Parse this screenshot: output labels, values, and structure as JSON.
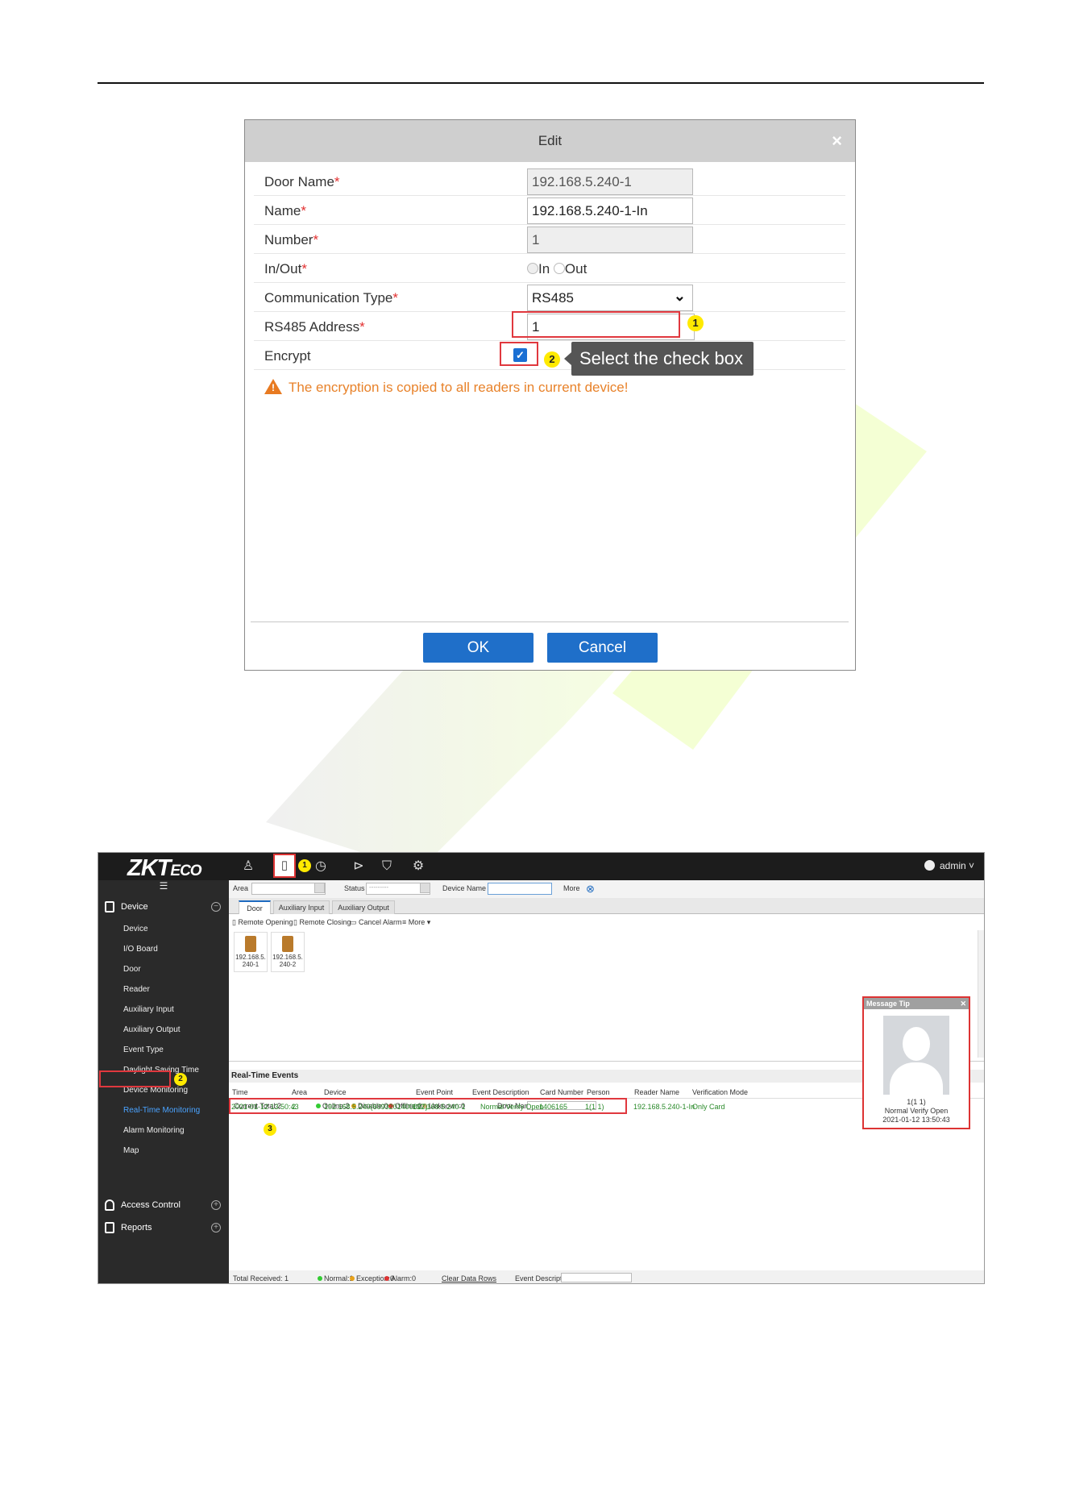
{
  "dialog": {
    "title": "Edit",
    "close_glyph": "×",
    "fields": {
      "door_name": {
        "label": "Door Name",
        "value": "192.168.5.240-1"
      },
      "name": {
        "label": "Name",
        "value": "192.168.5.240-1-In"
      },
      "number": {
        "label": "Number",
        "value": "1"
      },
      "in_out": {
        "label": "In/Out",
        "option_in": "In",
        "option_out": "Out"
      },
      "comm_type": {
        "label": "Communication Type",
        "value": "RS485"
      },
      "rs485_address": {
        "label": "RS485 Address",
        "value": "1"
      },
      "encrypt": {
        "label": "Encrypt",
        "checked": true
      }
    },
    "required_marker": "*",
    "tooltip": "Select the check box",
    "warning": "The encryption is copied to all readers in current device!",
    "ok_label": "OK",
    "cancel_label": "Cancel",
    "badges": [
      "1",
      "2"
    ]
  },
  "app": {
    "logo": {
      "zk": "ZK",
      "t": "T",
      "eco": "ECO"
    },
    "admin_label": "admin",
    "top_badge": "1",
    "sidebar": {
      "section_device": "Device",
      "items": [
        "Device",
        "I/O Board",
        "Door",
        "Reader",
        "Auxiliary Input",
        "Auxiliary Output",
        "Event Type",
        "Daylight Saving Time",
        "Device Monitoring",
        "Real-Time Monitoring",
        "Alarm Monitoring",
        "Map"
      ],
      "active_item": "Real-Time Monitoring",
      "badge": "2",
      "section_access": "Access Control",
      "section_reports": "Reports"
    },
    "filters": {
      "area": "Area",
      "status": "Status",
      "status_value": "---------",
      "device_name": "Device Name",
      "more": "More"
    },
    "tabs": [
      "Door",
      "Auxiliary Input",
      "Auxiliary Output"
    ],
    "toolbar": {
      "remote_opening": "Remote Opening",
      "remote_closing": "Remote Closing",
      "cancel_alarm": "Cancel Alarm",
      "more": "More"
    },
    "doors": [
      {
        "line1": "192.168.5.",
        "line2": "240-1"
      },
      {
        "line1": "192.168.5.",
        "line2": "240-2"
      }
    ],
    "door_status": {
      "current_total": "Current Total:2",
      "online": "Online:2",
      "disable": "Disable:0",
      "offline": "Offline:0",
      "unknown": "Unknown:0",
      "door_name": "Door Name"
    },
    "events": {
      "title": "Real-Time Events",
      "columns": [
        "Time",
        "Area",
        "Device",
        "Event Point",
        "Event Description",
        "Card Number",
        "Person",
        "Reader Name",
        "Verification Mode"
      ],
      "row": [
        "2021-01-12 13:50:43",
        "2",
        "192.168.5.240(6093201400027)",
        "192.168.5.240-1",
        "Normal Verify Open",
        "1406165",
        "1(1 1)",
        "192.168.5.240-1-In",
        "Only Card"
      ],
      "badge": "3"
    },
    "event_status": {
      "total_received": "Total Received: 1",
      "normal": "Normal:1",
      "exception": "Exception:0",
      "alarm": "Alarm:0",
      "clear": "Clear Data Rows",
      "event_description": "Event Description"
    },
    "message_tip": {
      "title": "Message Tip",
      "close": "✕",
      "person": "1(1 1)",
      "event": "Normal Verify Open",
      "time": "2021-01-12 13:50:43"
    }
  },
  "colors": {
    "accent": "#1f6fc9",
    "highlight": "#e0383e",
    "badge": "#ffea00",
    "event_green": "#2a8a2a",
    "warning": "#e8822a"
  }
}
